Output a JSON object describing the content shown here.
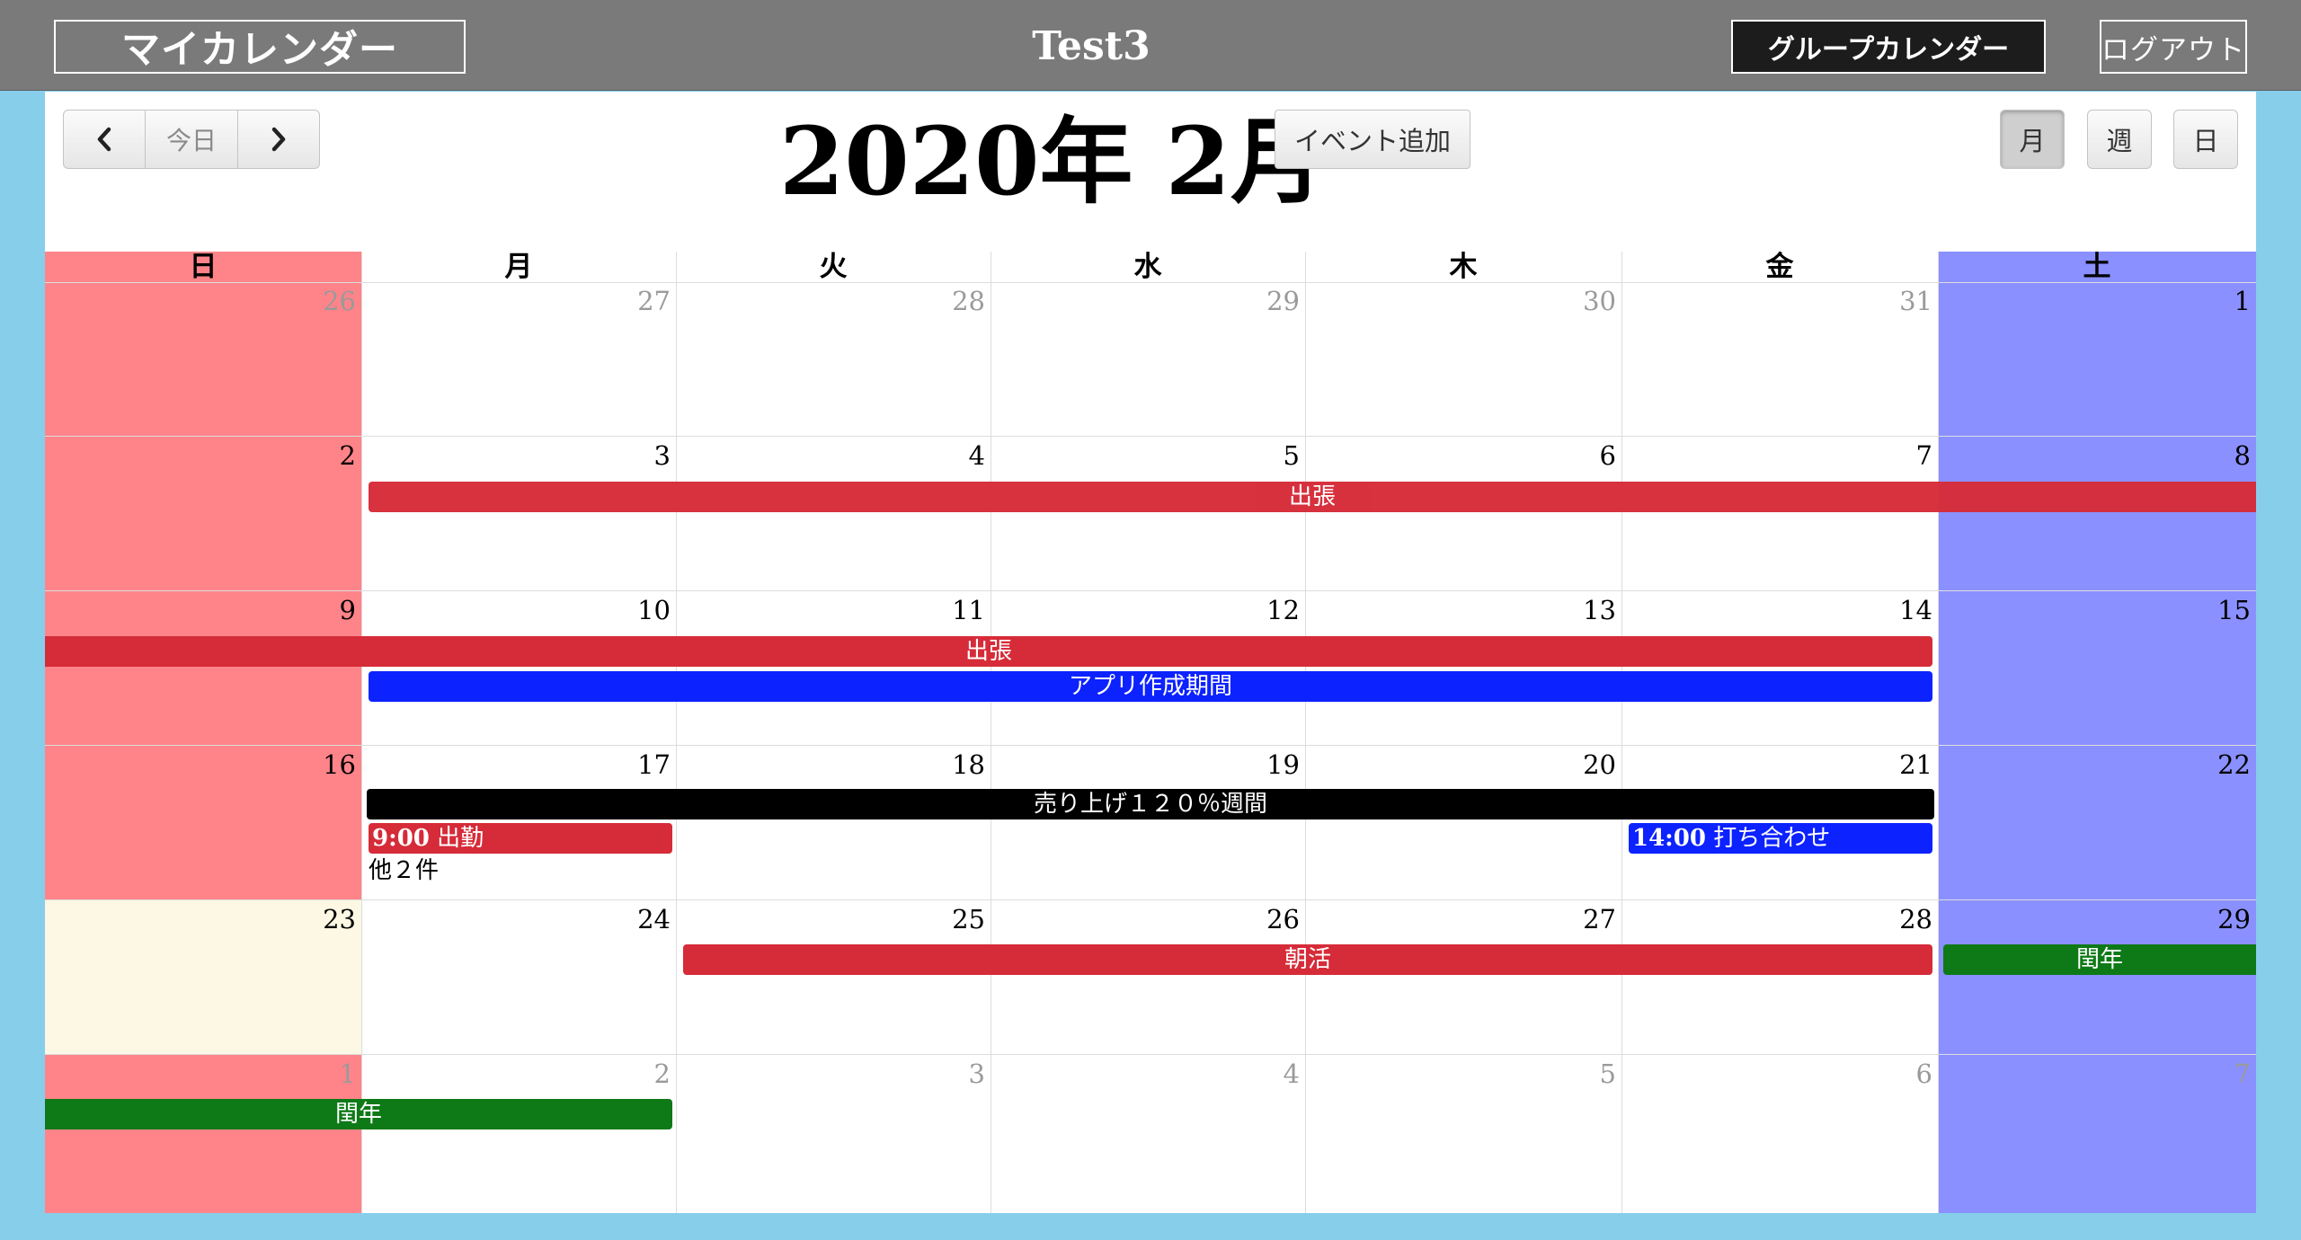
{
  "header": {
    "my_calendar_label": "マイカレンダー",
    "user_name": "Test3",
    "group_calendar_label": "グループカレンダー",
    "logout_label": "ログアウト",
    "bar_color": "#7a7a7a"
  },
  "toolbar": {
    "prev_icon": "chevron-left-icon",
    "today_label": "今日",
    "next_icon": "chevron-right-icon",
    "title": "2020年 2月",
    "add_event_label": "イベント追加",
    "views": [
      {
        "label": "月",
        "active": true
      },
      {
        "label": "週",
        "active": false
      },
      {
        "label": "日",
        "active": false
      }
    ]
  },
  "calendar": {
    "weekdays": [
      "日",
      "月",
      "火",
      "水",
      "木",
      "金",
      "土"
    ],
    "weeks": [
      [
        "26",
        "27",
        "28",
        "29",
        "30",
        "31",
        "1"
      ],
      [
        "2",
        "3",
        "4",
        "5",
        "6",
        "7",
        "8"
      ],
      [
        "9",
        "10",
        "11",
        "12",
        "13",
        "14",
        "15"
      ],
      [
        "16",
        "17",
        "18",
        "19",
        "20",
        "21",
        "22"
      ],
      [
        "23",
        "24",
        "25",
        "26",
        "27",
        "28",
        "29"
      ],
      [
        "1",
        "2",
        "3",
        "4",
        "5",
        "6",
        "7"
      ]
    ],
    "colors": {
      "sunday": "#ff8489",
      "saturday": "#8a90ff",
      "today": "#fcf8e3",
      "event_red": "#d62b38",
      "event_blue": "#0c22ff",
      "event_black": "#000000",
      "event_green": "#0e7a17"
    },
    "events": {
      "business_trip_1": "出張",
      "business_trip_2": "出張",
      "app_period": "アプリ作成期間",
      "sales_week": "売り上げ１２０％週間",
      "attend_time": "9:00",
      "attend_title": "出勤",
      "more_label": "他２件",
      "meeting_time": "14:00",
      "meeting_title": "打ち合わせ",
      "morning": "朝活",
      "leap_1": "閏年",
      "leap_2": "閏年"
    }
  }
}
